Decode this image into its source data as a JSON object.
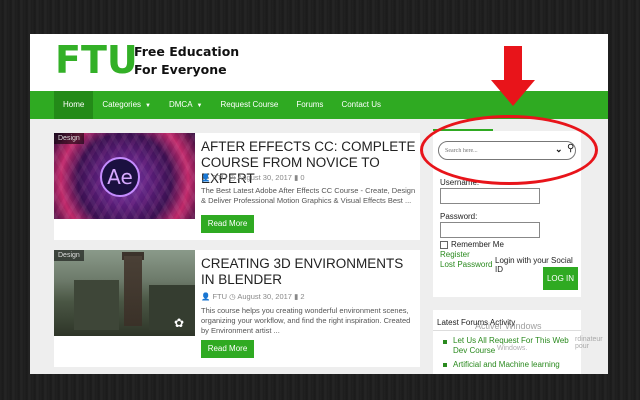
{
  "header": {
    "logo": "FTU",
    "tagline_line1": "Free Education",
    "tagline_line2": "For Everyone"
  },
  "nav": {
    "items": [
      {
        "label": "Home",
        "active": true,
        "dropdown": false
      },
      {
        "label": "Categories",
        "active": false,
        "dropdown": true
      },
      {
        "label": "DMCA",
        "active": false,
        "dropdown": true
      },
      {
        "label": "Request Course",
        "active": false,
        "dropdown": false
      },
      {
        "label": "Forums",
        "active": false,
        "dropdown": false
      },
      {
        "label": "Contact Us",
        "active": false,
        "dropdown": false
      }
    ]
  },
  "posts": [
    {
      "tag": "Design",
      "title": "AFTER EFFECTS CC: COMPLETE COURSE FROM NOVICE TO EXPERT",
      "author": "FTU",
      "date": "August 30, 2017",
      "comments": "0",
      "excerpt": "The Best Latest Adobe After Effects CC Course - Create, Design & Deliver Professional Motion Graphics & Visual Effects Best ...",
      "read_more": "Read More"
    },
    {
      "tag": "Design",
      "title": "CREATING 3D ENVIRONMENTS IN BLENDER",
      "author": "FTU",
      "date": "August 30, 2017",
      "comments": "2",
      "excerpt": "This course helps you creating wonderful environment scenes, organizing your workflow, and find the right inspiration. Created by Environment artist ...",
      "read_more": "Read More"
    }
  ],
  "sidebar": {
    "search": {
      "placeholder": "Search here..."
    },
    "login": {
      "username_label": "Username:",
      "password_label": "Password:",
      "remember_me": "Remember Me",
      "register": "Register",
      "lost_password": "Lost Password",
      "social": "Login with your Social ID",
      "login_button": "LOG IN"
    },
    "forums": {
      "title": "Latest Forums Activity",
      "items": [
        "Let Us All Request For This Web Dev Course",
        "Artificial and Machine learning"
      ]
    }
  },
  "overlay": {
    "watermark_line1": "Activer Windows",
    "watermark_line2": "Accédez aux paramètres de l'ordinateur pour activer Windows.",
    "watermark_visible_a": "rdinateur pour",
    "watermark_visible_b": "Windows.",
    "annotation_color": "#e8141a"
  },
  "colors": {
    "brand_green": "#2faa22",
    "nav_active": "#238a18"
  }
}
